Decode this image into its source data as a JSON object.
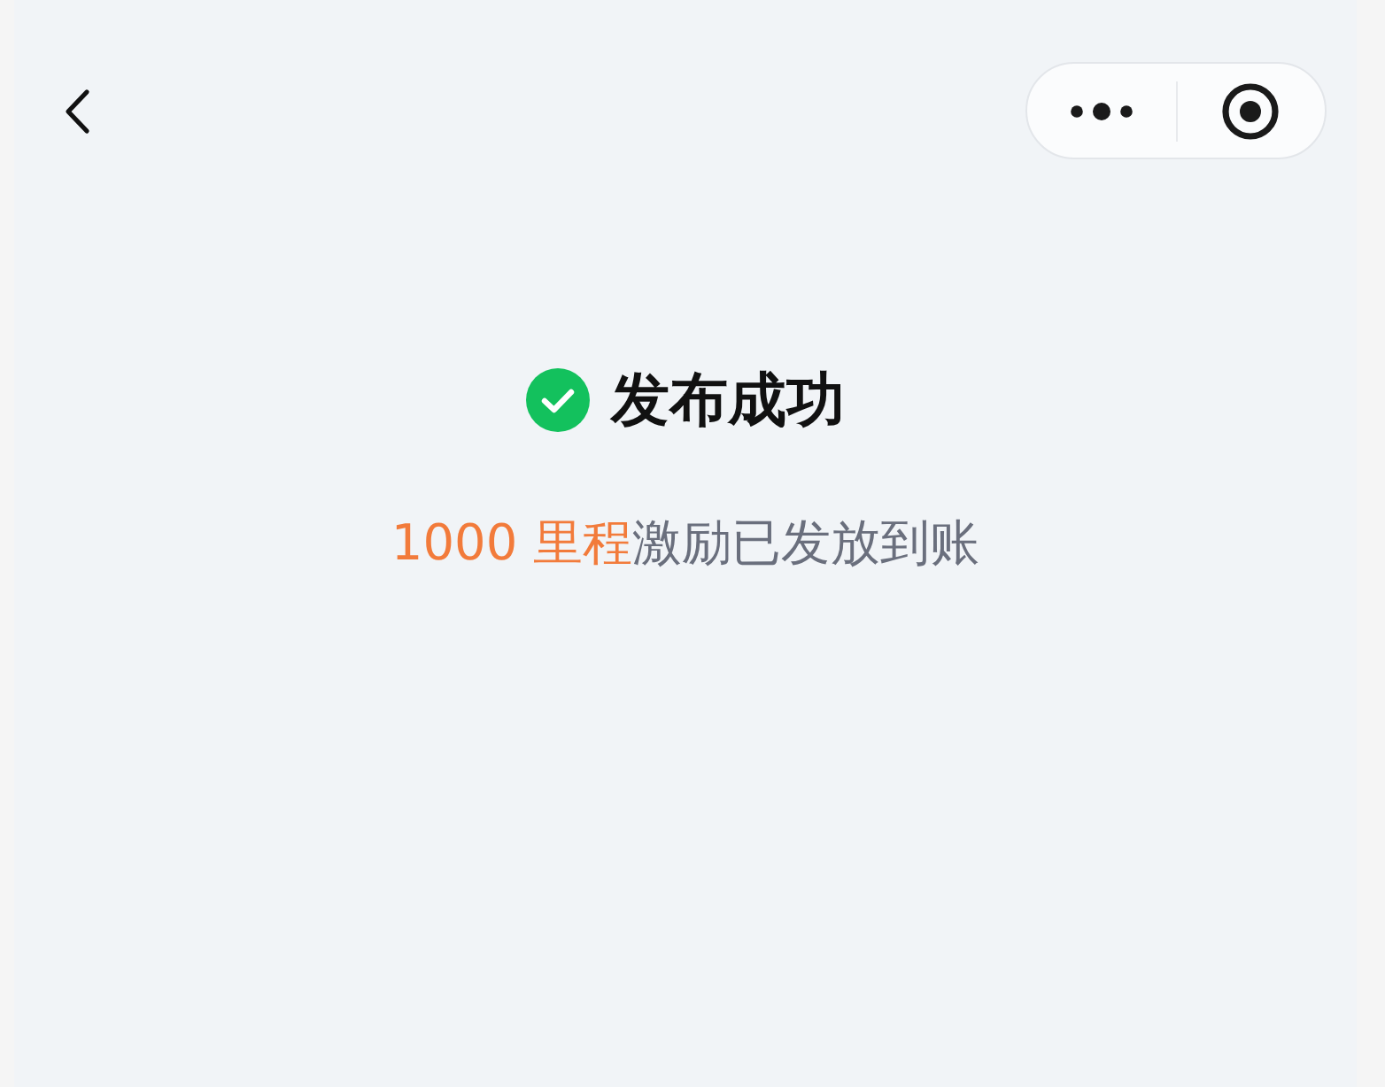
{
  "result": {
    "kind": "success",
    "title": "发布成功",
    "message": {
      "highlight": "1000 里程",
      "text": "激励已发放到账"
    }
  }
}
